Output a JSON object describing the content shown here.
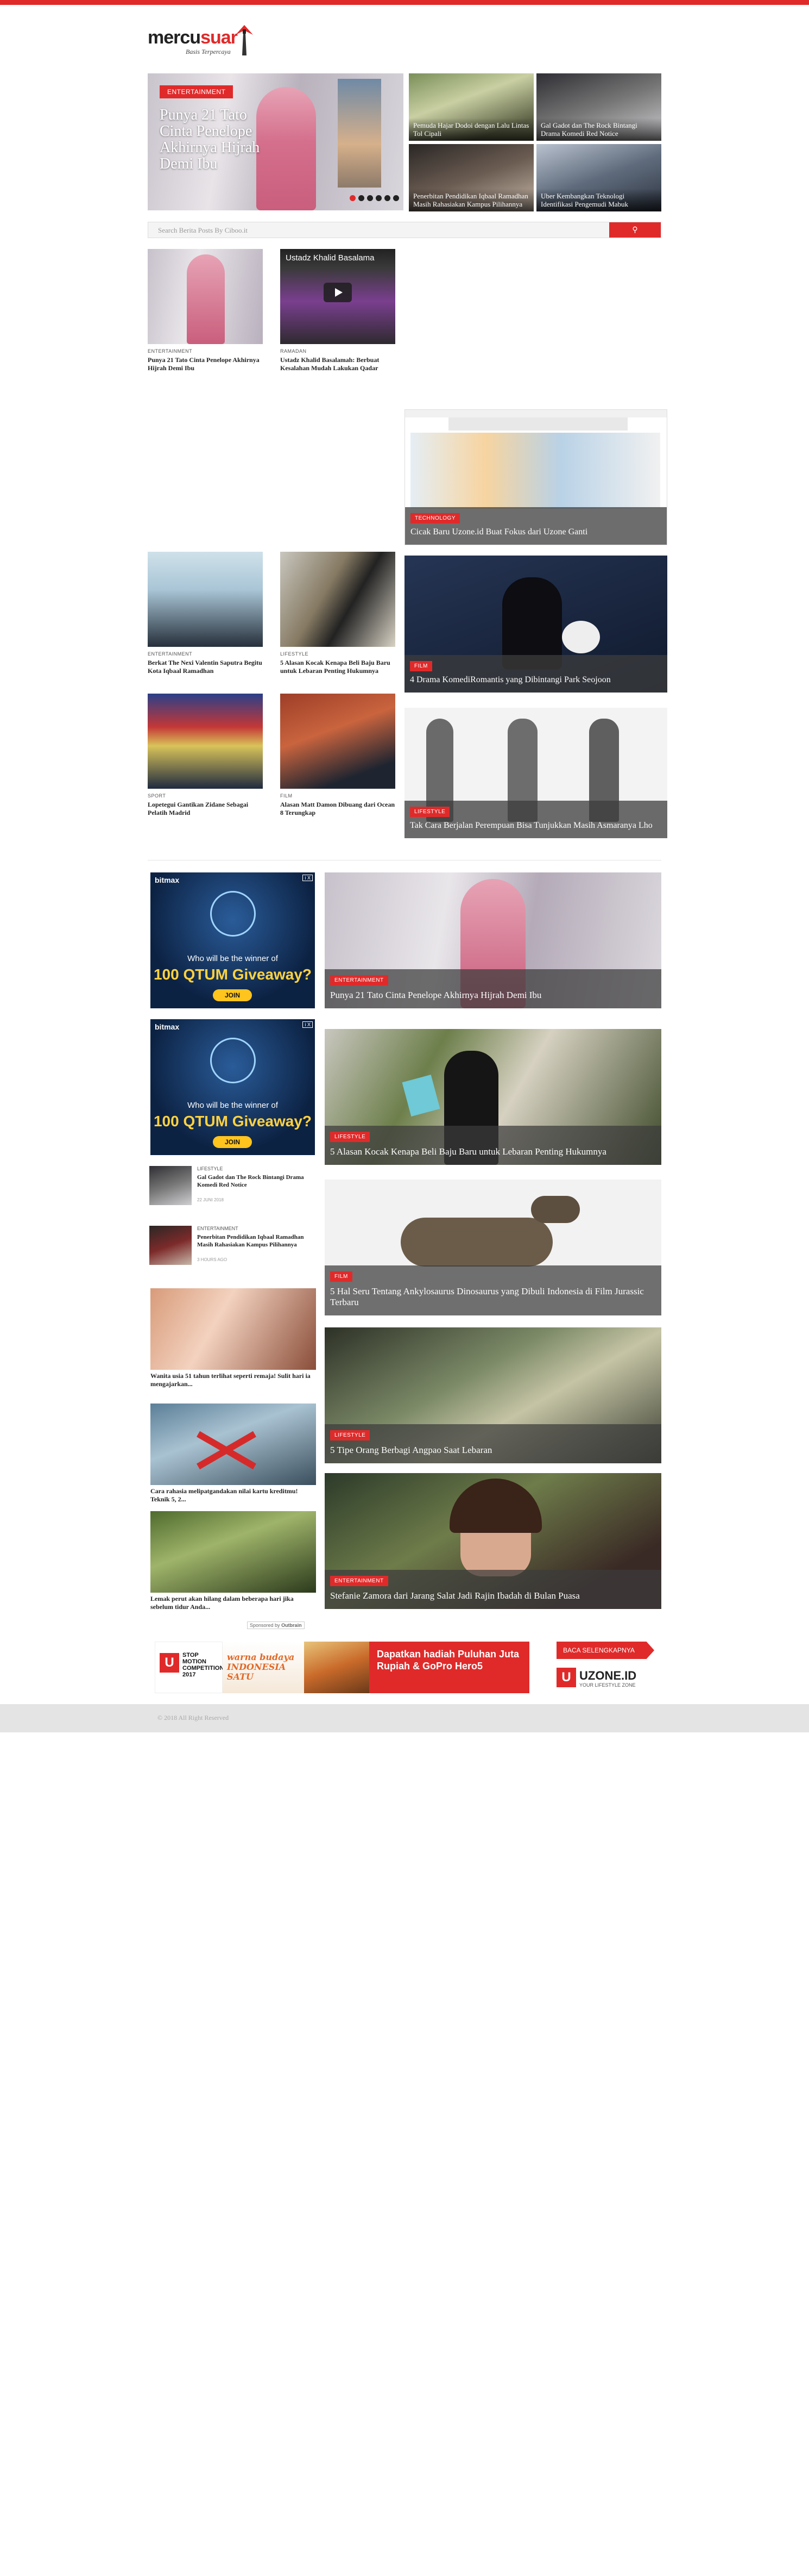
{
  "site": {
    "logo_main": "mercu",
    "logo_accent": "suar",
    "tagline": "Basis Terpercaya"
  },
  "hero": {
    "badge": "ENTERTAINMENT",
    "title": "Punya 21 Tato Cinta Penelope Akhirnya Hijrah Demi Ibu",
    "dots": 6,
    "active_dot": 1
  },
  "top_tiles": [
    {
      "title": "Pemuda Hajar Dodoi dengan Lalu Lintas Tol Cipali"
    },
    {
      "title": "Gal Gadot dan The Rock Bintangi Drama Komedi Red Notice"
    },
    {
      "title": "Penerbitan Pendidikan Iqbaal Ramadhan Masih Rahasiakan Kampus Pilihannya"
    },
    {
      "title": "Uber Kembangkan Teknologi Identifikasi Pengemudi Mabuk"
    }
  ],
  "search": {
    "placeholder": "Search Berita Posts By Ciboo.it",
    "button_icon": "search-icon"
  },
  "cards": [
    {
      "cat": "ENTERTAINMENT",
      "title": "Punya 21 Tato Cinta Penelope Akhirnya Hijrah Demi Ibu"
    },
    {
      "cat": "RAMADAN",
      "title": "Ustadz Khalid Basalamah: Berbuat Kesalahan Mudah Lakukan Qadar",
      "video_label": "Ustadz Khalid Basalama"
    },
    {
      "cat": "ENTERTAINMENT",
      "title": "Berkat The Nexi Valentin Saputra Begitu Kota Iqbaal Ramadhan"
    },
    {
      "cat": "LIFESTYLE",
      "title": "5 Alasan Kocak Kenapa Beli Baju Baru untuk Lebaran Penting Hukumnya"
    },
    {
      "cat": "SPORT",
      "title": "Lopetegui Gantikan Zidane Sebagai Pelatih Madrid"
    },
    {
      "cat": "FILM",
      "title": "Alasan Matt Damon Dibuang dari Ocean 8 Terungkap"
    }
  ],
  "right_big": [
    {
      "badge": "TECHNOLOGY",
      "title": "Cicak Baru Uzone.id Buat Fokus dari Uzone Ganti"
    },
    {
      "badge": "FILM",
      "title": "4 Drama KomediRomantis yang Dibintangi Park Seojoon"
    },
    {
      "badge": "LIFESTYLE",
      "title": "Tak Cara Berjalan Perempuan Bisa Tunjukkan Masih Asmaranya Lho"
    }
  ],
  "ads": [
    {
      "brand": "bitmax",
      "headline": "Who will be the winner of",
      "prize": "100 QTUM Giveaway?",
      "join": "JOIN",
      "corner": "i X"
    },
    {
      "brand": "bitmax",
      "headline": "Who will be the winner of",
      "prize": "100 QTUM Giveaway?",
      "join": "JOIN",
      "corner": "i X"
    }
  ],
  "mini_list": [
    {
      "cat": "LIFESTYLE",
      "title": "Gal Gadot dan The Rock Bintangi Drama Komedi Red Notice",
      "date": "22 JUNI 2018"
    },
    {
      "cat": "ENTERTAINMENT",
      "title": "Penerbitan Pendidikan Iqbaal Ramadhan Masih Rahasiakan Kampus Pilihannya",
      "date": "3 HOURS AGO"
    }
  ],
  "sponsored_items": [
    {
      "title": "Wanita usia 51 tahun terlihat seperti remaja! Sulit hari ia mengajarkan..."
    },
    {
      "title": "Cara rahasia melipatgandakan nilai kartu kreditmu! Teknik 5, 2..."
    },
    {
      "title": "Lemak perut akan hilang dalam beberapa hari jika sebelum tidur Anda..."
    }
  ],
  "sponsored_label": "Sponsored by",
  "sponsored_brand": "Outbrain",
  "features": [
    {
      "badge": "ENTERTAINMENT",
      "title": "Punya 21 Tato Cinta Penelope Akhirnya Hijrah Demi Ibu"
    },
    {
      "badge": "LIFESTYLE",
      "title": "5 Alasan Kocak Kenapa Beli Baju Baru untuk Lebaran Penting Hukumnya"
    },
    {
      "badge": "FILM",
      "title": "5 Hal Seru Tentang Ankylosaurus Dinosaurus yang Dibuli Indonesia di Film Jurassic Terbaru"
    },
    {
      "badge": "LIFESTYLE",
      "title": "5 Tipe Orang Berbagi Angpao Saat Lebaran"
    },
    {
      "badge": "ENTERTAINMENT",
      "title": "Stefanie Zamora dari Jarang Salat Jadi Rajin Ibadah di Bulan Puasa"
    }
  ],
  "banner": {
    "left_brand": "U",
    "left_text": "STOP MOTION COMPETITION 2017",
    "middle_text": "warna budaya INDONESIA SATU",
    "prize_text": "Dapatkan hadiah Puluhan Juta Rupiah & GoPro Hero5",
    "cta": "BACA SELENGKAPNYA",
    "right_brand": "UZONE.ID",
    "right_tag": "YOUR LIFESTYLE ZONE"
  },
  "footer": {
    "copyright": "© 2018 All Right Reserved"
  }
}
